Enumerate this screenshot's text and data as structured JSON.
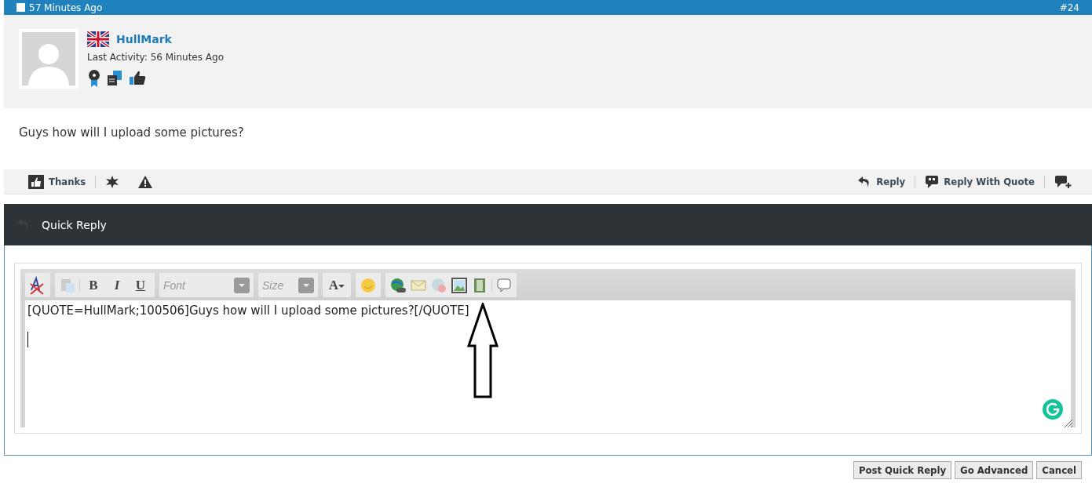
{
  "post_header": {
    "time": "57 Minutes Ago",
    "number": "#24",
    "checked": false
  },
  "author": {
    "name": "HullMark",
    "last_activity": "Last Activity: 56 Minutes Ago"
  },
  "post_text": "Guys how will I upload some pictures?",
  "post_actions": {
    "left": [
      "Thanks"
    ],
    "right": [
      "Reply",
      "Reply With Quote"
    ]
  },
  "quick_reply": {
    "title": "Quick Reply",
    "toolbar": {
      "bold": "B",
      "italic": "I",
      "underline": "U",
      "font": "Font",
      "size": "Size",
      "text_color": "A"
    },
    "editor_text": "[QUOTE=HullMark;100506]Guys how will I upload some pictures?[/QUOTE]"
  },
  "buttons": [
    "Post Quick Reply",
    "Go Advanced",
    "Cancel"
  ]
}
